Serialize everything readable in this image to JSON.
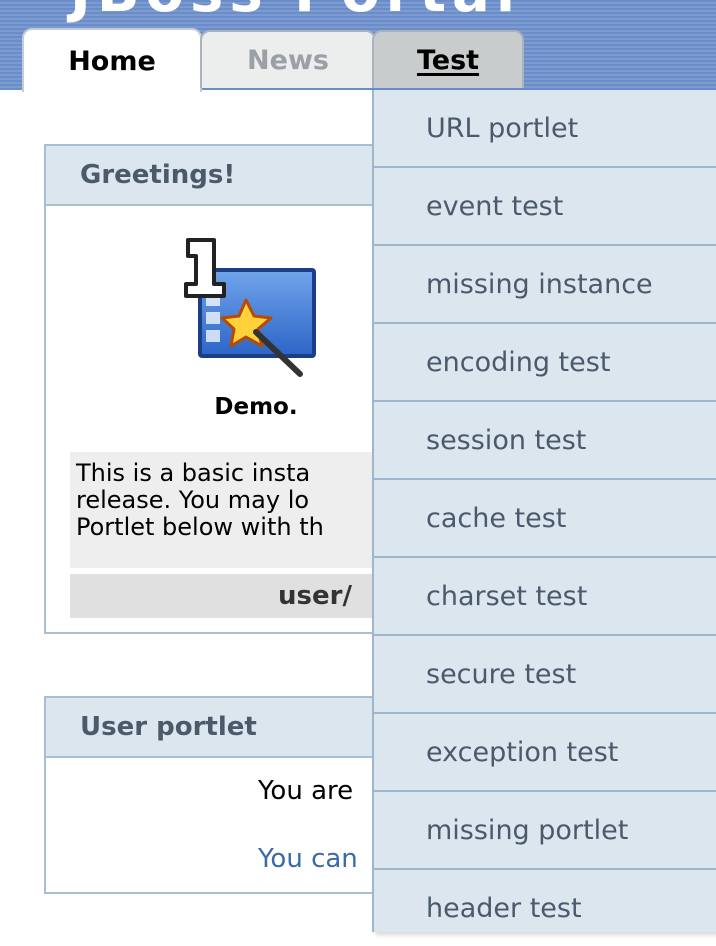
{
  "header": {
    "title": "JBoss Portal"
  },
  "tabs": [
    {
      "label": "Home",
      "state": "active"
    },
    {
      "label": "News",
      "state": "inactive"
    },
    {
      "label": "Test",
      "state": "hover"
    }
  ],
  "greetings_portlet": {
    "title": "Greetings!",
    "icon_caption": "Demo.",
    "description": "This is a basic insta\nrelease. You may lo\nPortlet below with th",
    "user_path": "user/"
  },
  "user_portlet": {
    "title": "User portlet",
    "line1": "You are",
    "line2": "You can"
  },
  "test_menu": {
    "items": [
      "URL portlet",
      "event test",
      "missing instance",
      "encoding test",
      "session test",
      "cache test",
      "charset test",
      "secure test",
      "exception test",
      "missing portlet",
      "header test"
    ]
  },
  "colors": {
    "header_band": "#6a8cc8",
    "portlet_title_bg": "#dce6ee",
    "portlet_border": "#a6bfd5",
    "menu_bg": "#dce6ee",
    "menu_text": "#4a5a6c",
    "link": "#3a6aa8"
  },
  "icons": {
    "demo": "demo-wizard-icon"
  }
}
